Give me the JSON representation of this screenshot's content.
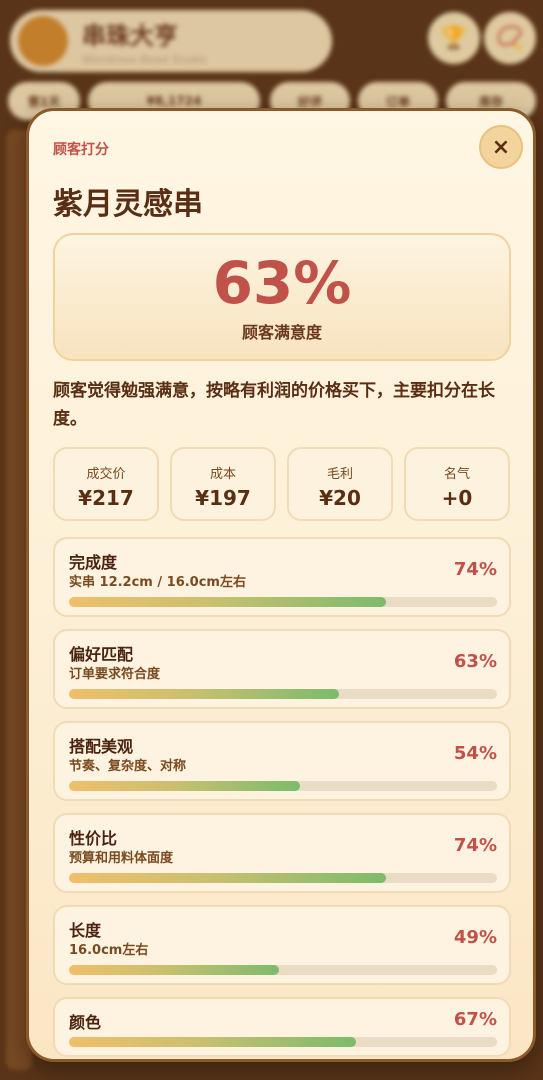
{
  "background": {
    "app_title": "串珠大亨",
    "app_subtitle": "Wondrous Bead Studio",
    "chips": [
      "第1天",
      "¥8,1724",
      "好评",
      "订单",
      "库存"
    ]
  },
  "modal": {
    "label": "顾客打分",
    "close_icon": "×",
    "title": "紫月灵感串",
    "score": {
      "value": "63%",
      "label": "顾客满意度"
    },
    "comment": "顾客觉得勉强满意，按略有利润的价格买下，主要扣分在长度。",
    "stats": [
      {
        "label": "成交价",
        "value": "¥217"
      },
      {
        "label": "成本",
        "value": "¥197"
      },
      {
        "label": "毛利",
        "value": "¥20"
      },
      {
        "label": "名气",
        "value": "+0"
      }
    ],
    "criteria": [
      {
        "name": "完成度",
        "desc": "实串 12.2cm / 16.0cm左右",
        "pct": "74%",
        "value": 74
      },
      {
        "name": "偏好匹配",
        "desc": "订单要求符合度",
        "pct": "63%",
        "value": 63
      },
      {
        "name": "搭配美观",
        "desc": "节奏、复杂度、对称",
        "pct": "54%",
        "value": 54
      },
      {
        "name": "性价比",
        "desc": "预算和用料体面度",
        "pct": "74%",
        "value": 74
      },
      {
        "name": "长度",
        "desc": "16.0cm左右",
        "pct": "49%",
        "value": 49
      },
      {
        "name": "颜色",
        "desc": "",
        "pct": "67%",
        "value": 67
      }
    ]
  },
  "colors": {
    "accent": "#c0524a",
    "brown": "#5a2e14",
    "bar_start": "#f0bf6a",
    "bar_end": "#7cbb6c"
  }
}
